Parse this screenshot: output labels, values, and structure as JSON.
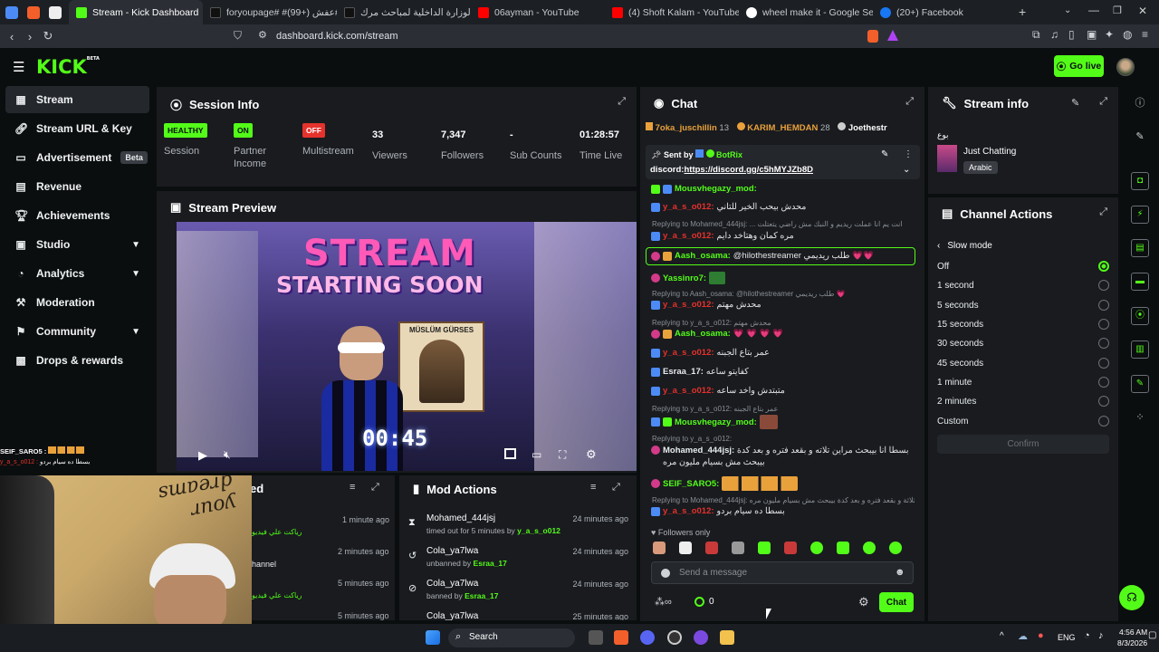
{
  "browser": {
    "tabs": [
      {
        "label": "Stream - Kick Dashboard",
        "active": true
      },
      {
        "label": "foryoupage#  #علاجة#عفش (+99)"
      },
      {
        "label": "استعالة لوزارة الداخلية لمباحث مرك"
      },
      {
        "label": "06ayman - YouTube"
      },
      {
        "label": "(4) Shoft Kalam - YouTube"
      },
      {
        "label": "wheel make it - Google Search"
      },
      {
        "label": "(20+) Facebook"
      }
    ],
    "url": "dashboard.kick.com/stream"
  },
  "header": {
    "logo": "KICK",
    "logo_sup": "BETA",
    "go_live": "Go live"
  },
  "sidebar": {
    "items": [
      {
        "label": "Stream",
        "icon": "stream-icon"
      },
      {
        "label": "Stream URL & Key",
        "icon": "link-icon"
      },
      {
        "label": "Advertisement",
        "badge": "Beta",
        "icon": "ad-icon"
      },
      {
        "label": "Revenue",
        "icon": "revenue-icon"
      },
      {
        "label": "Achievements",
        "icon": "trophy-icon"
      },
      {
        "label": "Studio",
        "icon": "studio-icon"
      },
      {
        "label": "Analytics",
        "icon": "analytics-icon"
      },
      {
        "label": "Moderation",
        "icon": "hammer-icon"
      },
      {
        "label": "Community",
        "icon": "community-icon"
      },
      {
        "label": "Drops & rewards",
        "icon": "gift-icon"
      }
    ]
  },
  "session": {
    "title": "Session Info",
    "stats": [
      {
        "value": "HEALTHY",
        "label": "Session",
        "pill": "green"
      },
      {
        "value": "ON",
        "label": "Partner Income",
        "pill": "green"
      },
      {
        "value": "OFF",
        "label": "Multistream",
        "pill": "red"
      },
      {
        "value": "33",
        "label": "Viewers"
      },
      {
        "value": "7,347",
        "label": "Followers"
      },
      {
        "value": "-",
        "label": "Sub Counts"
      },
      {
        "value": "01:28:57",
        "label": "Time Live"
      }
    ]
  },
  "preview": {
    "title": "Stream Preview",
    "overlay_line1": "STREAM",
    "overlay_line2": "STARTING SOON",
    "poster_name": "MÜSLÜM GÜRSES",
    "timer": "00:45"
  },
  "bottom_left": {
    "title": "ed",
    "rows": [
      {
        "text": "رياكت علي فيديو",
        "time": "1 minute ago"
      },
      {
        "text": "hannel",
        "time": "2 minutes ago"
      },
      {
        "text": "رياكت علي فيديو",
        "time": "5 minutes ago"
      },
      {
        "text": "",
        "time": "5 minutes ago"
      }
    ]
  },
  "webcam_chat": [
    {
      "user": "SEIF_SARO5 :",
      "msg": ""
    },
    {
      "user": "y_a_s_o012 :",
      "msg": "بسطا ده سيام بردو"
    }
  ],
  "mod_actions": {
    "title": "Mod Actions",
    "rows": [
      {
        "user": "Mohamed_444jsj",
        "action": "timed out for 5 minutes by",
        "by": "y_a_s_o012",
        "time": "24 minutes ago",
        "icon": "hourglass-icon"
      },
      {
        "user": "Cola_ya7lwa",
        "action": "unbanned by",
        "by": "Esraa_17",
        "time": "24 minutes ago",
        "icon": "undo-icon"
      },
      {
        "user": "Cola_ya7lwa",
        "action": "banned by",
        "by": "Esraa_17",
        "time": "24 minutes ago",
        "icon": "ban-icon"
      },
      {
        "user": "Cola_ya7lwa",
        "action": "",
        "by": "",
        "time": "25 minutes ago",
        "icon": "ban-icon"
      }
    ]
  },
  "chat": {
    "title": "Chat",
    "top_gifters": [
      {
        "name": "7oka_juschillin",
        "count": "13"
      },
      {
        "name": "KARIM_HEMDAN",
        "count": "28"
      },
      {
        "name": "Joethestr",
        "count": ""
      }
    ],
    "pinned": {
      "sent_by": "Sent by",
      "bot": "BotRix",
      "label": "discord:",
      "link": "https://discord.gg/c5hMYJZb8D"
    },
    "messages": [
      {
        "user": "Mousvhegazy_mod:",
        "msg": "",
        "color": "#53fc18",
        "reply": ""
      },
      {
        "user": "y_a_s_o012:",
        "msg": "محدش بيحب الخير للتاني",
        "color": "#e5322c",
        "reply": ""
      },
      {
        "user": "y_a_s_o012:",
        "msg": "مره كمان وهتاخد دايم",
        "color": "#e5322c",
        "reply": "Replying to Mohamed_444jsj: ... انت يم انا عملت ريديم و النبك مش راضي يتعتلت"
      },
      {
        "user": "Aash_osama:",
        "msg": "@hilothestreamer طلب ريديمي 💗💗",
        "color": "#53fc18",
        "reply": "",
        "highlight": true
      },
      {
        "user": "Yassinro7:",
        "msg": "",
        "color": "#53fc18",
        "reply": ""
      },
      {
        "user": "y_a_s_o012:",
        "msg": "محدش مهتم",
        "color": "#e5322c",
        "reply": "Replying to Aash_osama: @hilothestreamer طلب ريديمي 💗"
      },
      {
        "user": "Aash_osama:",
        "msg": "💗 💗 💗 💗",
        "color": "#53fc18",
        "reply": "Replying to y_a_s_o012: محدش مهتم"
      },
      {
        "user": "y_a_s_o012:",
        "msg": "عمر بتاع الجبنه",
        "color": "#e5322c",
        "reply": ""
      },
      {
        "user": "Esraa_17:",
        "msg": "كفايتو ساعه",
        "color": "#e8ecef",
        "reply": ""
      },
      {
        "user": "y_a_s_o012:",
        "msg": "متبتدش واخد ساعه",
        "color": "#e5322c",
        "reply": ""
      },
      {
        "user": "Mousvhegazy_mod:",
        "msg": "",
        "color": "#53fc18",
        "reply": "Replying to y_a_s_o012: عمر بتاع الجبنه"
      },
      {
        "user": "Mohamed_444jsj:",
        "msg": "بسطا انا بيبحث مراين تلاته و بقعد فتره و بعد كدة بيبحث مش بسيام مليون مره",
        "color": "#e8ecef",
        "reply": "Replying to y_a_s_o012:"
      },
      {
        "user": "SEIF_SARO5:",
        "msg": "",
        "color": "#53fc18",
        "reply": ""
      },
      {
        "user": "y_a_s_o012:",
        "msg": "بسطا ده سيام بردو",
        "color": "#e5322c",
        "reply": "Replying to Mohamed_444jsj: انا ثلاثة و بقعد فتره و بعد كدة بيبحث مش بسيام مليون مره"
      }
    ],
    "followers_only": "Followers only",
    "input_placeholder": "Send a message",
    "points": "0",
    "send_label": "Chat"
  },
  "stream_info": {
    "title": "Stream info",
    "heading": "بوع",
    "category": "Just Chatting",
    "language": "Arabic"
  },
  "channel_actions": {
    "title": "Channel Actions",
    "back_label": "Slow mode",
    "options": [
      "Off",
      "1 second",
      "5 seconds",
      "15 seconds",
      "30 seconds",
      "45 seconds",
      "1 minute",
      "2 minutes",
      "Custom"
    ],
    "selected": "Off",
    "confirm": "Confirm"
  },
  "taskbar": {
    "search": "Search",
    "lang": "ENG",
    "time": "4:56 AM",
    "date": "8/3/2026"
  },
  "colors": {
    "accent": "#53fc18",
    "danger": "#e5322c",
    "panel": "#191b1f",
    "bg": "#0b0e0f"
  }
}
